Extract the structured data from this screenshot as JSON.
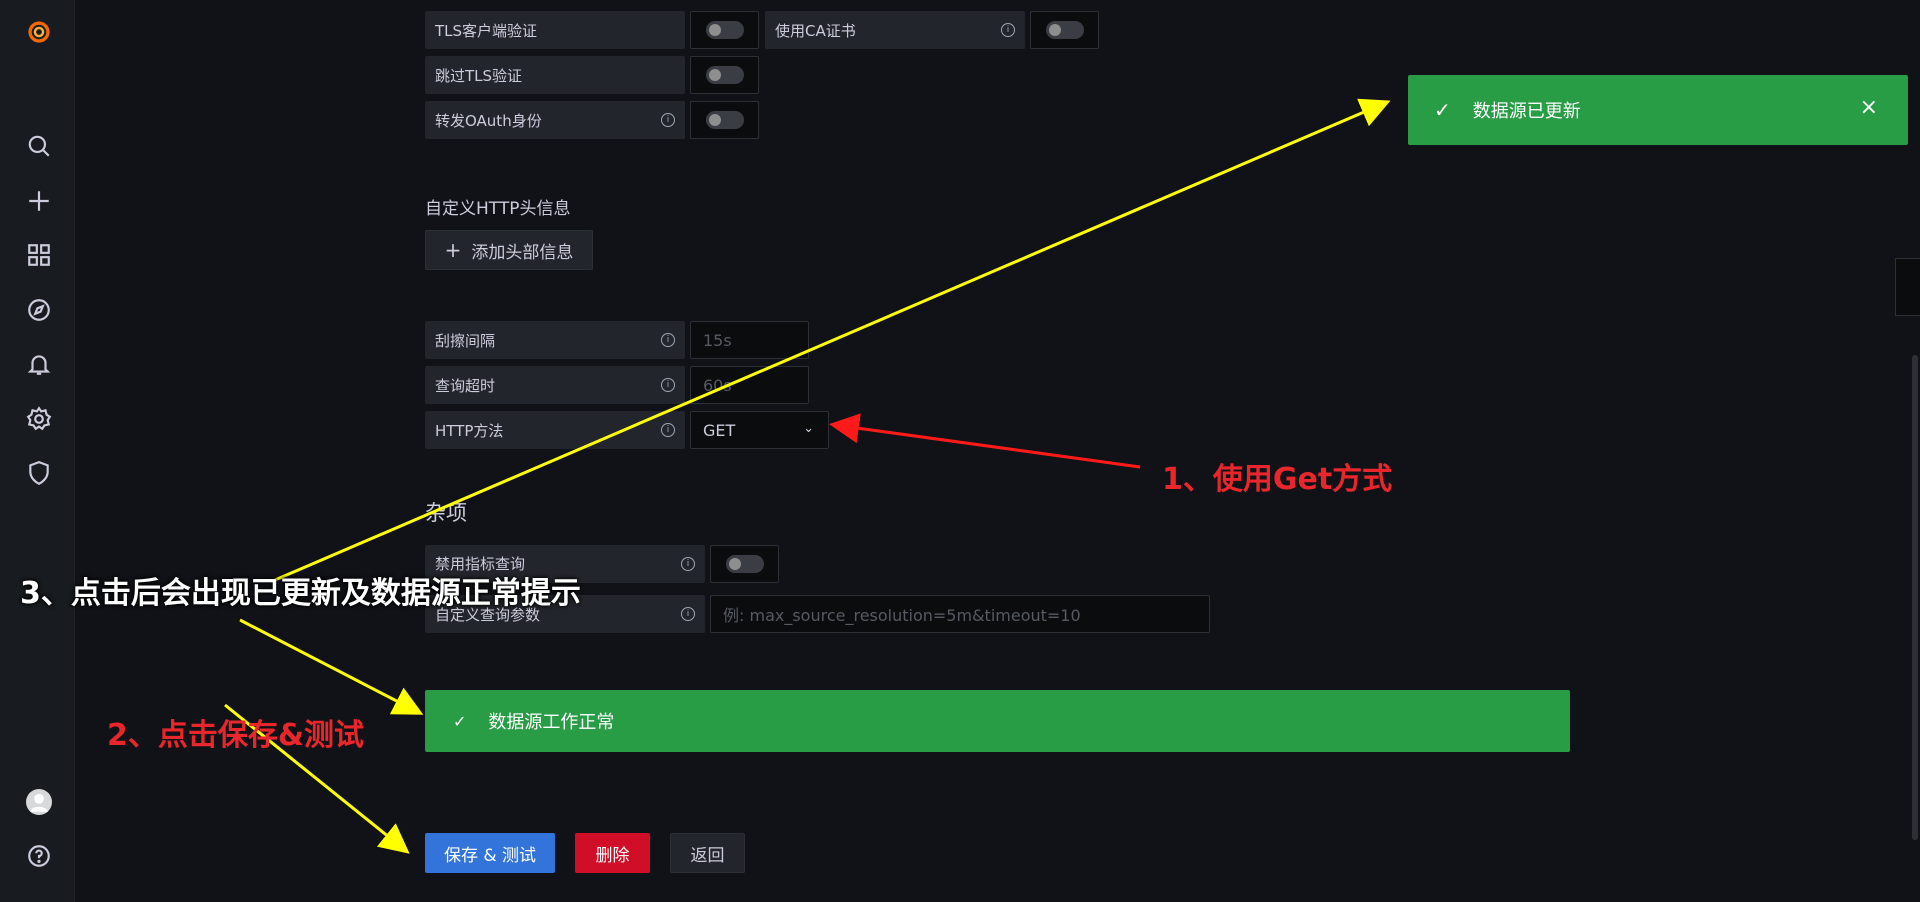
{
  "sidebar": {
    "icons": [
      "grafana-logo",
      "search-icon",
      "plus-icon",
      "dashboards-icon",
      "explore-icon",
      "bell-icon",
      "gear-icon",
      "shield-icon",
      "avatar",
      "help-icon"
    ]
  },
  "auth": {
    "tls_client_label": "TLS客户端验证",
    "use_ca_label": "使用CA证书",
    "skip_tls_label": "跳过TLS验证",
    "forward_oauth_label": "转发OAuth身份"
  },
  "headers": {
    "title": "自定义HTTP头信息",
    "add_button_label": "添加头部信息"
  },
  "prometheus": {
    "scrape_interval_label": "刮擦间隔",
    "scrape_interval_placeholder": "15s",
    "query_timeout_label": "查询超时",
    "query_timeout_placeholder": "60s",
    "http_method_label": "HTTP方法",
    "http_method_value": "GET"
  },
  "misc": {
    "title": "杂项",
    "disable_metrics_label": "禁用指标查询",
    "custom_params_label": "自定义查询参数",
    "custom_params_placeholder": "例: max_source_resolution=5m&timeout=10"
  },
  "alert": {
    "message": "数据源工作正常",
    "color": "#299c46"
  },
  "toast": {
    "message": "数据源已更新",
    "color": "#299c46"
  },
  "actions": {
    "save_test_label": "保存 & 测试",
    "delete_label": "删除",
    "back_label": "返回",
    "save_color": "#3274d9",
    "delete_color": "#d10e27"
  },
  "annotations": {
    "step1": "1、使用Get方式",
    "step2": "2、点击保存&测试",
    "step3": "3、点击后会出现已更新及数据源正常提示"
  }
}
